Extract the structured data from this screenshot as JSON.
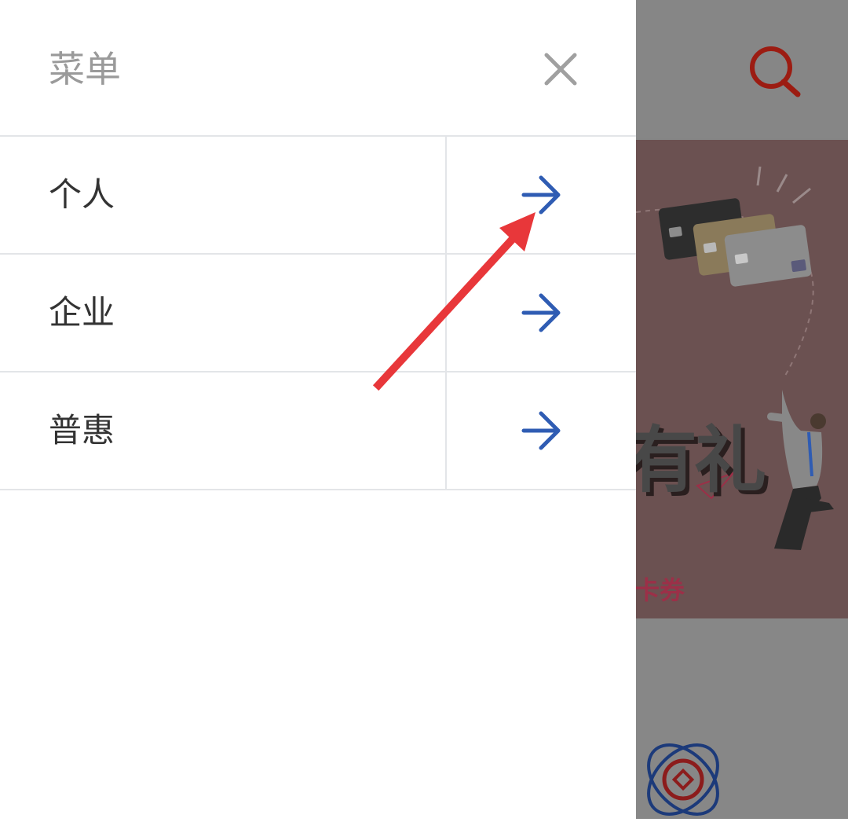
{
  "drawer": {
    "title": "菜单",
    "close_icon": "close-icon"
  },
  "menu": {
    "items": [
      {
        "label": "个人",
        "icon": "arrow-right-icon"
      },
      {
        "label": "企业",
        "icon": "arrow-right-icon"
      },
      {
        "label": "普惠",
        "icon": "arrow-right-icon"
      }
    ]
  },
  "background": {
    "search_icon": "search-icon",
    "banner_text": "有礼",
    "banner_subtext": "卡券",
    "logo_icon": "bank-logo-icon"
  },
  "colors": {
    "accent_blue": "#2f5cb3",
    "search_red": "#9c1c12",
    "annotation_red": "#e8373a",
    "title_gray": "#9a9a9a",
    "divider": "#e3e5e8"
  }
}
